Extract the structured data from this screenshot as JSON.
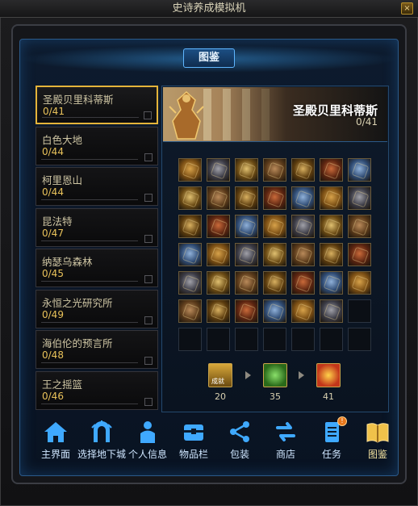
{
  "window": {
    "title": "史诗养成模拟机",
    "close_label": "×"
  },
  "panel": {
    "heading": "图鉴"
  },
  "dungeons": [
    {
      "name": "圣殿贝里科蒂斯",
      "count": "0/41",
      "selected": true
    },
    {
      "name": "白色大地",
      "count": "0/44",
      "selected": false
    },
    {
      "name": "柯里恩山",
      "count": "0/44",
      "selected": false
    },
    {
      "name": "昆法特",
      "count": "0/47",
      "selected": false
    },
    {
      "name": "纳瑟乌森林",
      "count": "0/45",
      "selected": false
    },
    {
      "name": "永恒之光研究所",
      "count": "0/49",
      "selected": false
    },
    {
      "name": "海伯伦的预言所",
      "count": "0/48",
      "selected": false
    },
    {
      "name": "王之摇篮",
      "count": "0/46",
      "selected": false
    }
  ],
  "detail": {
    "title": "圣殿贝里科蒂斯",
    "count": "0/41",
    "grid_rows": 7,
    "grid_cols": 7,
    "filled_cells": 41
  },
  "rewards": [
    {
      "name": "chest-icon",
      "label": "20",
      "chest_text": "成就"
    },
    {
      "name": "potion-icon",
      "label": "35"
    },
    {
      "name": "gem-box-icon",
      "label": "41"
    }
  ],
  "nav": [
    {
      "key": "home",
      "label": "主界面",
      "icon": "house-icon"
    },
    {
      "key": "dungeon",
      "label": "选择地下城",
      "icon": "gate-icon"
    },
    {
      "key": "profile",
      "label": "个人信息",
      "icon": "person-icon"
    },
    {
      "key": "inventory",
      "label": "物品栏",
      "icon": "chest-icon"
    },
    {
      "key": "share",
      "label": "包装",
      "icon": "share-icon"
    },
    {
      "key": "shop",
      "label": "商店",
      "icon": "exchange-icon"
    },
    {
      "key": "quest",
      "label": "任务",
      "icon": "document-icon",
      "badge": "!"
    },
    {
      "key": "codex",
      "label": "图鉴",
      "icon": "book-icon",
      "active": true
    }
  ],
  "colors": {
    "accent_gold": "#e4b43a",
    "panel_blue": "#2b5a8a",
    "item_icon_warm": "#c98a2a",
    "item_icon_cool": "#5a7fb0"
  }
}
